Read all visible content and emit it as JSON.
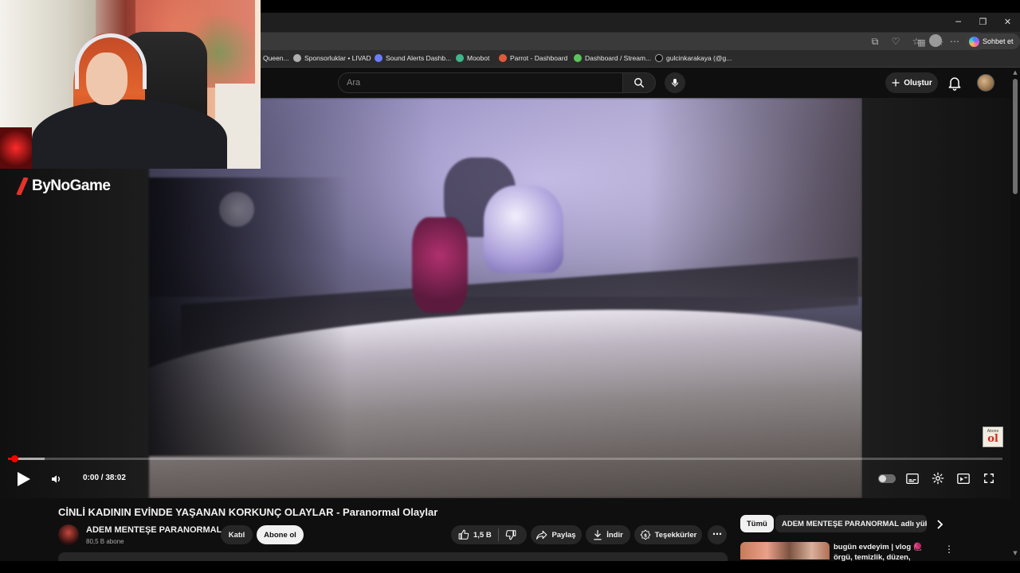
{
  "window": {
    "minimize": "─",
    "restore": "❐",
    "close": "✕"
  },
  "browser": {
    "copilot_label": "Sohbet et",
    "bookmarks": [
      {
        "label": "Queen...",
        "color": "#c0a060"
      },
      {
        "label": "Sponsorluklar • LIVAD",
        "color": "#b0b0b0"
      },
      {
        "label": "Sound Alerts Dashb...",
        "color": "#6c7cff"
      },
      {
        "label": "Moobot",
        "color": "#3fb68b"
      },
      {
        "label": "Parrot - Dashboard",
        "color": "#e05a3a"
      },
      {
        "label": "Dashboard / Stream...",
        "color": "#5cc35c"
      },
      {
        "label": "gulcinkarakaya (@g...",
        "color": "#111111"
      }
    ]
  },
  "youtube": {
    "search_placeholder": "Ara",
    "create_label": "Oluştur"
  },
  "overlay": {
    "brand": "ByNoGame"
  },
  "player": {
    "time": "0:00 / 38:02",
    "progress_played": 0.004,
    "progress_buffered": 0.037,
    "abone_small": "Abone",
    "abone_big": "ol"
  },
  "video": {
    "title": "CİNLİ KADININ EVİNDE YAŞANAN KORKUNÇ OLAYLAR - Paranormal Olaylar",
    "channel_name": "ADEM MENTEŞE PARANORMAL",
    "subscribers": "80,5 B abone",
    "join_label": "Katıl",
    "subscribe_label": "Abone ol",
    "likes": "1,5 B",
    "share_label": "Paylaş",
    "download_label": "İndir",
    "thanks_label": "Teşekkürler"
  },
  "sidebar": {
    "chips": [
      "Tümü",
      "ADEM MENTEŞE PARANORMAL adlı yükleyiciden"
    ],
    "recommendation_title": "bugün evdeyim | vlog 🧶 örgü, temizlik, düzen, paketler, biraz"
  }
}
